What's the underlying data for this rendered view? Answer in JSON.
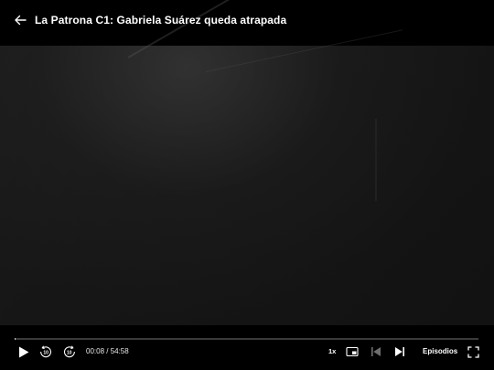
{
  "header": {
    "title": "La Patrona C1: Gabriela Suárez queda atrapada",
    "back_icon": "arrow-left-icon"
  },
  "controls": {
    "current_time": "00:08",
    "duration": "54:58",
    "time_display": "00:08 / 54:58",
    "progress_fraction": 0.0024,
    "rewind_seconds": "10",
    "forward_seconds": "10",
    "speed_label": "1x",
    "episodes_label": "Episodios",
    "icons": {
      "play": "play-icon",
      "rewind": "rewind-10-icon",
      "forward": "forward-10-icon",
      "pip": "picture-in-picture-icon",
      "previous": "previous-episode-icon",
      "next": "next-episode-icon",
      "fullscreen": "fullscreen-icon"
    }
  },
  "colors": {
    "background": "#000000",
    "text": "#ffffff",
    "progress_track": "#3a3a3a",
    "progress_fill": "#c8c8c8",
    "disabled": "#6e6e6e"
  }
}
